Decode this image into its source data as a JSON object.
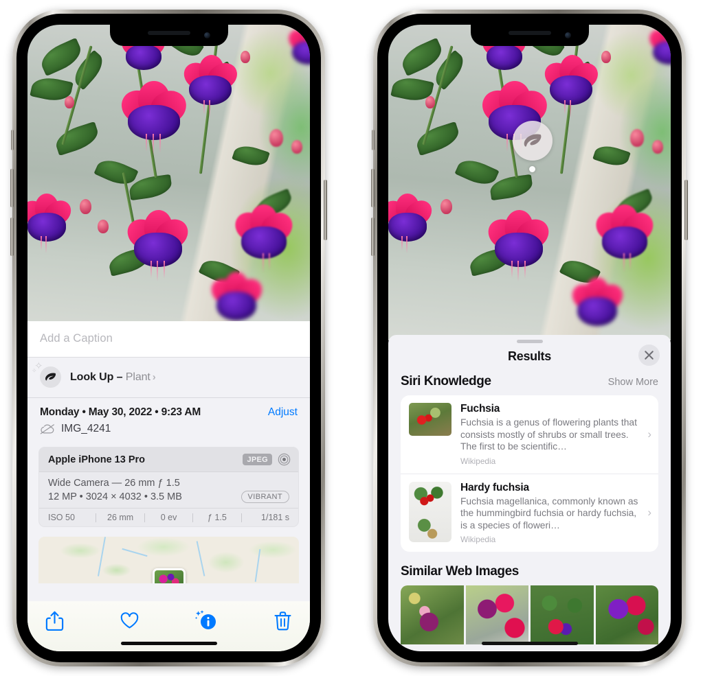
{
  "left_phone": {
    "caption": {
      "placeholder": "Add a Caption",
      "value": ""
    },
    "lookup": {
      "label": "Look Up",
      "dash": " – ",
      "subject": "Plant",
      "chevron": "›",
      "icon": "leaf-icon"
    },
    "meta": {
      "date_line": "Monday • May 30, 2022 • 9:23 AM",
      "adjust_label": "Adjust",
      "filename": "IMG_4241",
      "cloud_icon": "cloud-slash-icon"
    },
    "exif": {
      "device": "Apple iPhone 13 Pro",
      "format_badge": "JPEG",
      "lens_icon": "lens-circles-icon",
      "lens_line": "Wide Camera — 26 mm ƒ 1.5",
      "size_line": "12 MP • 3024 × 4032 • 3.5 MB",
      "color_badge": "VIBRANT",
      "stats": [
        "ISO 50",
        "26 mm",
        "0 ev",
        "ƒ 1.5",
        "1/181 s"
      ]
    },
    "toolbar": {
      "share_label": "share-icon",
      "favorite_label": "heart-icon",
      "info_label": "info-sparkle-icon",
      "delete_label": "trash-icon"
    }
  },
  "right_phone": {
    "badge": {
      "icon": "leaf-icon"
    },
    "sheet": {
      "title": "Results",
      "close_label": "✕"
    },
    "siri_knowledge": {
      "heading": "Siri Knowledge",
      "action": "Show More",
      "items": [
        {
          "title": "Fuchsia",
          "snippet": "Fuchsia is a genus of flowering plants that consists mostly of shrubs or small trees. The first to be scientific…",
          "source": "Wikipedia",
          "chevron": "›"
        },
        {
          "title": "Hardy fuchsia",
          "snippet": "Fuchsia magellanica, commonly known as the hummingbird fuchsia or hardy fuchsia, is a species of floweri…",
          "source": "Wikipedia",
          "chevron": "›"
        }
      ]
    },
    "similar_web_images": {
      "heading": "Similar Web Images",
      "count": 4
    }
  },
  "colors": {
    "accent_blue": "#007AFF",
    "sheet_bg": "#F2F2F6",
    "card_bg": "#FFFFFF",
    "text_primary": "#111114",
    "text_secondary": "#7A7A80",
    "badge_grey": "#A9A9AE"
  }
}
